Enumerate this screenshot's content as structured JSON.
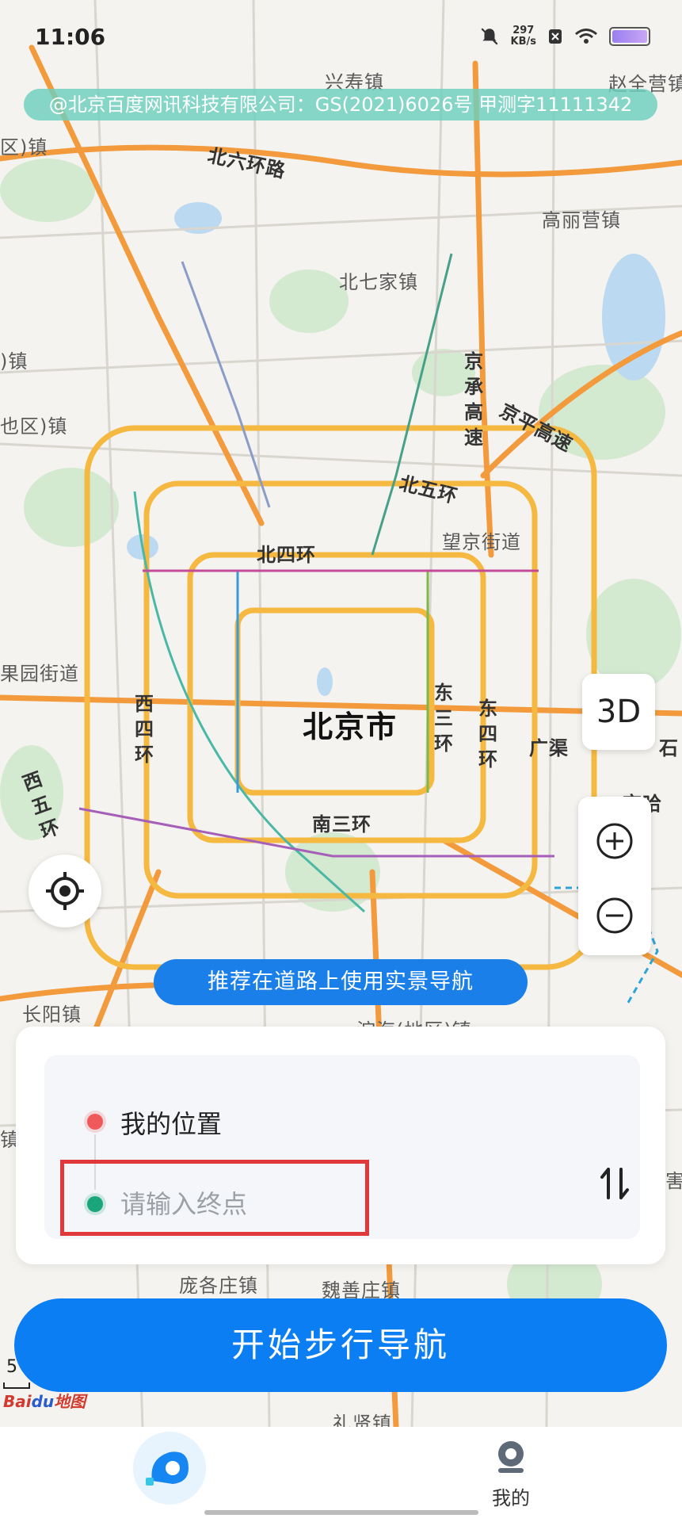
{
  "status_bar": {
    "time": "11:06",
    "speed_value": "297",
    "speed_unit": "KB/s"
  },
  "map": {
    "copyright": "@北京百度网讯科技有限公司：GS(2021)6026号 甲测字11111342",
    "city": "北京市",
    "place_labels": {
      "xingshou": "兴寿镇",
      "zhaoquanying": "赵全营镇",
      "district_top": "区)镇",
      "gaoliying": "高丽营镇",
      "beiqijia": "北七家镇",
      "district_mid1": ")镇",
      "district_mid2": "也区)镇",
      "wangjing": "望京街道",
      "pingguoyuan": "果园街道",
      "changyang": "长阳镇",
      "panggezhuang": "庞各庄镇",
      "weishanzhuang": "魏善庄镇",
      "district_bottom": "淀海(地区)镇",
      "lixian": "礼贤镇",
      "right_bottom": "害",
      "right_mid": "镇"
    },
    "road_labels": {
      "beiliuhuan": "北六环路",
      "jingchenggaosu": "京承高速",
      "jingpinggaosu": "京平高速",
      "beiwuhuan": "北五环",
      "beisihuan": "北四环",
      "xisihuan": "西四环",
      "dongsanhuan": "东三环",
      "dongsihuan": "东四环",
      "guangqu": "广渠",
      "xiwuhuan": "西五环",
      "nansanhuan": "南三环",
      "jingha": "京哈",
      "edge": "石"
    }
  },
  "controls": {
    "btn_3d": "3D",
    "hint": "推荐在道路上使用实景导航"
  },
  "route": {
    "origin": "我的位置",
    "destination_placeholder": "请输入终点",
    "destination_value": ""
  },
  "start_button": "开始步行导航",
  "scale_value": "5",
  "logo": {
    "text_a": "Bai",
    "text_b": "du",
    "text_c": "地图"
  },
  "bottom_nav": {
    "mine_label": "我的"
  },
  "colors": {
    "primary": "#0a7ef2",
    "hint_pill": "#1a7fe8",
    "highlight": "#e0393b",
    "origin_dot": "#f0595c",
    "dest_dot": "#1aa57a",
    "ring_road": "#f5b942",
    "expressway": "#f29a3c"
  }
}
